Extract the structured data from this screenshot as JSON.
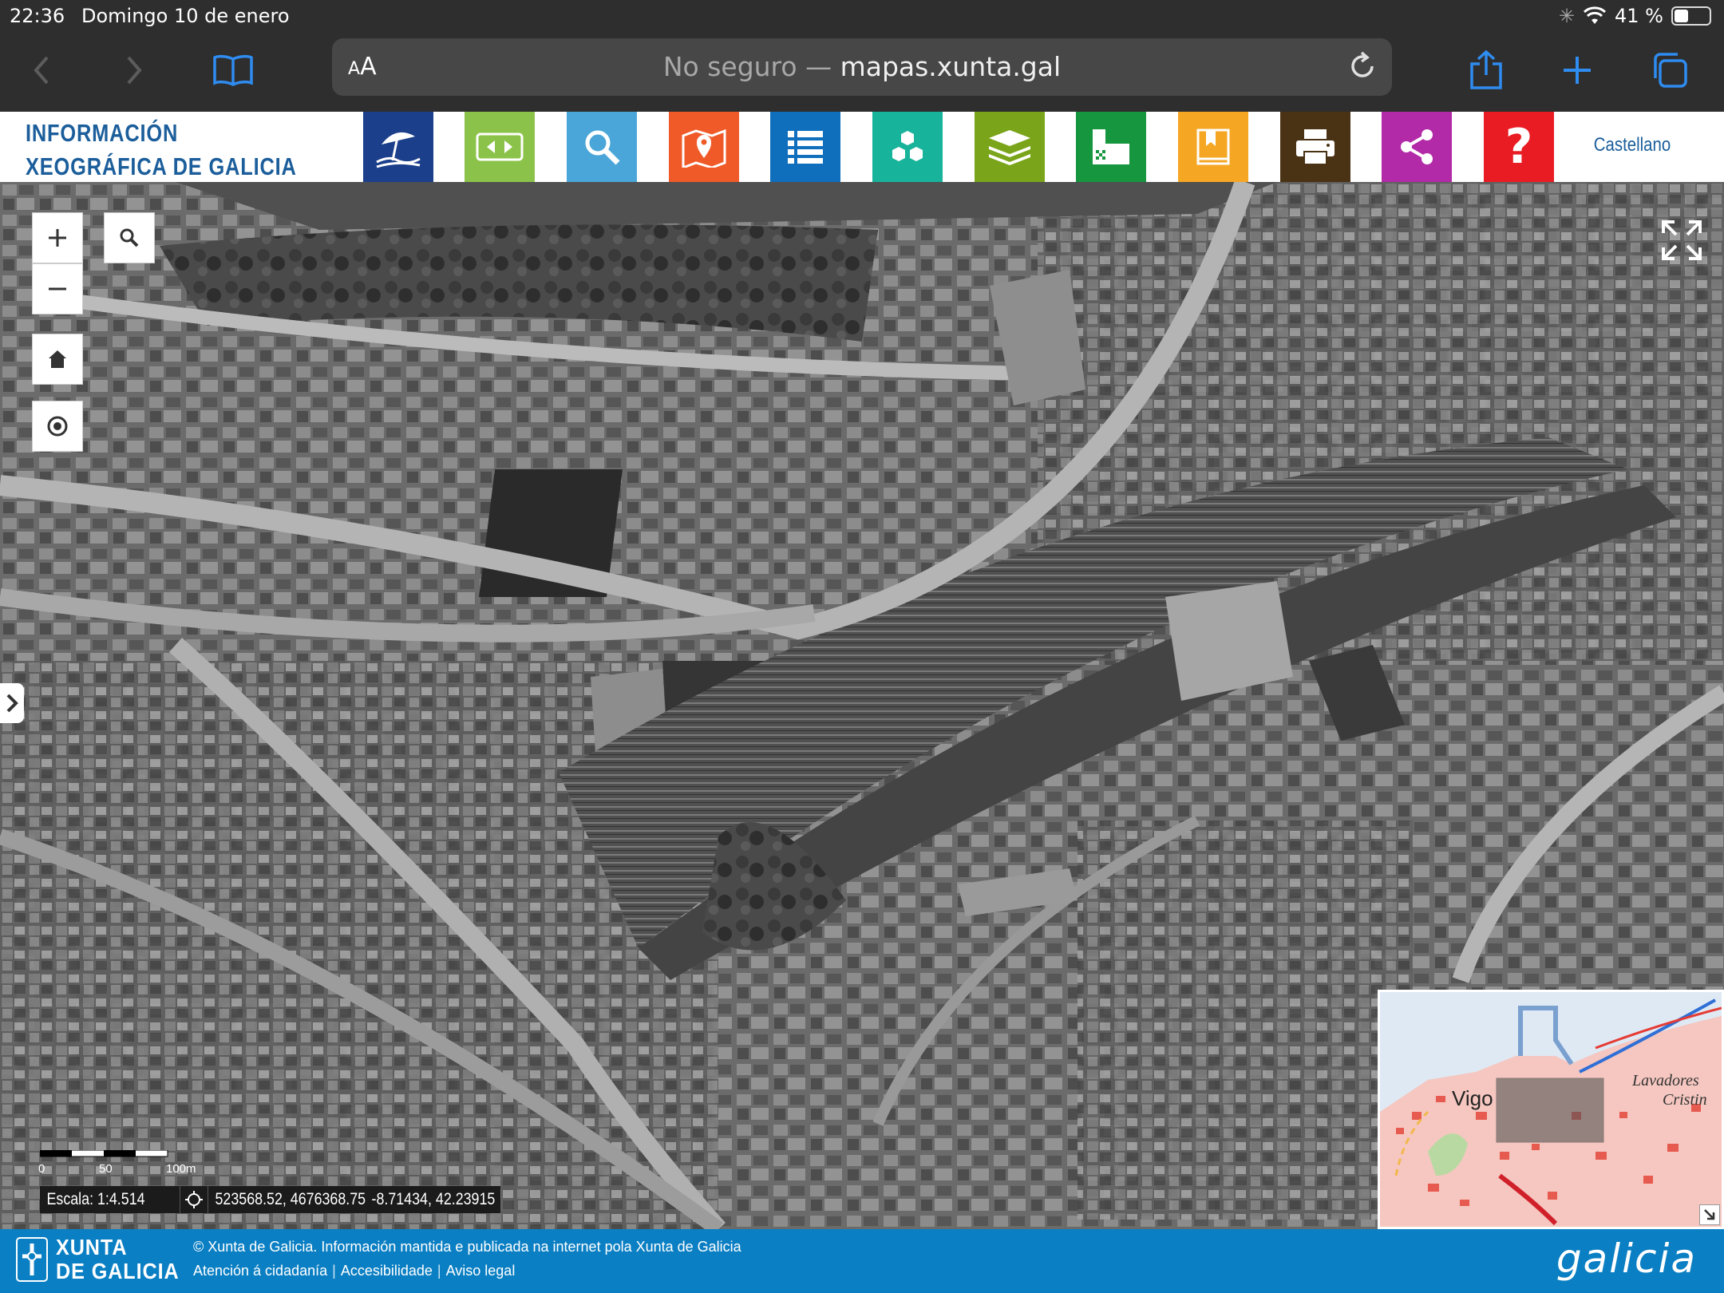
{
  "status_bar": {
    "time": "22:36",
    "date": "Domingo 10 de enero",
    "battery": "41 %",
    "battery_level": 0.41
  },
  "browser": {
    "text_size_label": "AA",
    "address_prefix": "No seguro —",
    "address_host": "mapas.xunta.gal"
  },
  "site": {
    "brand_line1": "INFORMACIÓN",
    "brand_line2": "XEOGRÁFICA DE GALICIA",
    "language": "Castellano",
    "nav_buttons": [
      {
        "name": "beach-icon",
        "color": "#1b3f8b"
      },
      {
        "name": "swap-icon",
        "color": "#8bc34a"
      },
      {
        "name": "search-icon",
        "color": "#4aa6d8"
      },
      {
        "name": "map-pin-icon",
        "color": "#f05a28"
      },
      {
        "name": "list-icon",
        "color": "#0f6fbd"
      },
      {
        "name": "hexagons-icon",
        "color": "#17b39b"
      },
      {
        "name": "layers-icon",
        "color": "#7aa51a"
      },
      {
        "name": "grid-icon",
        "color": "#15963f"
      },
      {
        "name": "bookmark-icon",
        "color": "#f5a623"
      },
      {
        "name": "print-icon",
        "color": "#4a3214"
      },
      {
        "name": "share-icon",
        "color": "#b32aa8"
      },
      {
        "name": "help-icon",
        "color": "#e91c24"
      }
    ]
  },
  "map": {
    "scale_label": "Escala: 1:4.514",
    "scale_ticks": [
      "0",
      "50",
      "100m"
    ],
    "coords_utm": "523568.52, 4676368.75",
    "coords_geo": "-8.71434, 42.23915",
    "overview_labels": [
      "Vigo",
      "Lavadores",
      "Cristin"
    ]
  },
  "footer": {
    "org_line1": "XUNTA",
    "org_line2": "DE GALICIA",
    "copyright": "© Xunta de Galicia. Información mantida e publicada na internet pola Xunta de Galicia",
    "links": [
      "Atención á cidadanía",
      "Accesibilidade",
      "Aviso legal"
    ],
    "galicia_logo": "galicia"
  }
}
